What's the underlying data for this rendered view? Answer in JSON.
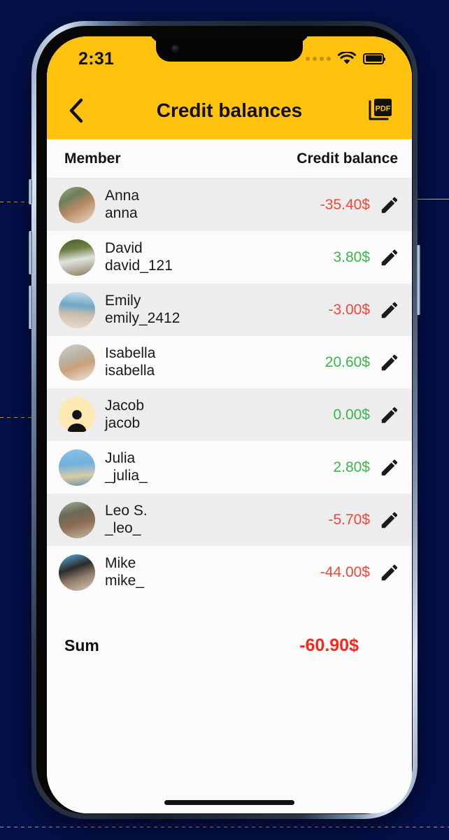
{
  "theme": {
    "brand_yellow": "#FFC20E",
    "negative_color": "#F4463A",
    "positive_color": "#3CB54A",
    "sum_color": "#F4291B",
    "page_background": "#041049"
  },
  "status_bar": {
    "time": "2:31",
    "signal_icon": "signal-dots-icon",
    "wifi_icon": "wifi-icon",
    "battery_icon": "battery-full-icon"
  },
  "app_bar": {
    "back_icon": "chevron-left-icon",
    "title": "Credit balances",
    "pdf_icon": "pdf-export-icon"
  },
  "table": {
    "headers": {
      "member": "Member",
      "balance": "Credit balance"
    },
    "rows": [
      {
        "name": "Anna",
        "username": "anna",
        "balance": "-35.40$",
        "sign": "neg",
        "avatar": "photo-anna",
        "avatar_type": "photo"
      },
      {
        "name": "David",
        "username": "david_121",
        "balance": "3.80$",
        "sign": "pos",
        "avatar": "photo-david",
        "avatar_type": "photo"
      },
      {
        "name": "Emily",
        "username": "emily_2412",
        "balance": "-3.00$",
        "sign": "neg",
        "avatar": "photo-emily",
        "avatar_type": "photo"
      },
      {
        "name": "Isabella",
        "username": "isabella",
        "balance": "20.60$",
        "sign": "pos",
        "avatar": "photo-isabella",
        "avatar_type": "photo"
      },
      {
        "name": "Jacob",
        "username": "jacob",
        "balance": "0.00$",
        "sign": "pos",
        "avatar": "person-placeholder-icon",
        "avatar_type": "placeholder"
      },
      {
        "name": "Julia",
        "username": "_julia_",
        "balance": "2.80$",
        "sign": "pos",
        "avatar": "photo-julia",
        "avatar_type": "photo"
      },
      {
        "name": "Leo S.",
        "username": "_leo_",
        "balance": "-5.70$",
        "sign": "neg",
        "avatar": "photo-leo",
        "avatar_type": "photo"
      },
      {
        "name": "Mike",
        "username": "mike_",
        "balance": "-44.00$",
        "sign": "neg",
        "avatar": "photo-mike",
        "avatar_type": "photo"
      }
    ],
    "edit_icon": "pencil-edit-icon"
  },
  "summary": {
    "label": "Sum",
    "value": "-60.90$"
  }
}
